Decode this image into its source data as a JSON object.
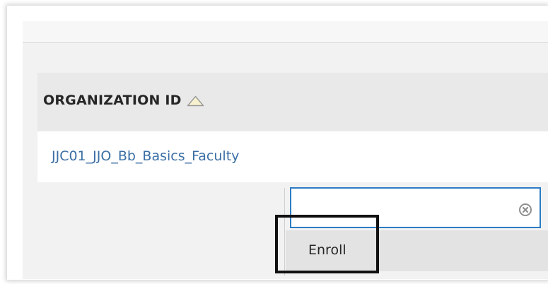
{
  "table": {
    "column_header": "ORGANIZATION ID",
    "sort_icon": "sort-ascending-triangle-icon",
    "rows": [
      {
        "organization_id": "JJC01_JJO_Bb_Basics_Faculty"
      }
    ]
  },
  "context_menu": {
    "search_value": "",
    "clear_icon": "clear-circle-x-icon",
    "items": [
      {
        "label": "Enroll"
      }
    ]
  },
  "colors": {
    "link": "#3b6fa5",
    "focus_border": "#2c7cc4",
    "header_bg": "#e9e9e9",
    "highlight": "#111111"
  }
}
